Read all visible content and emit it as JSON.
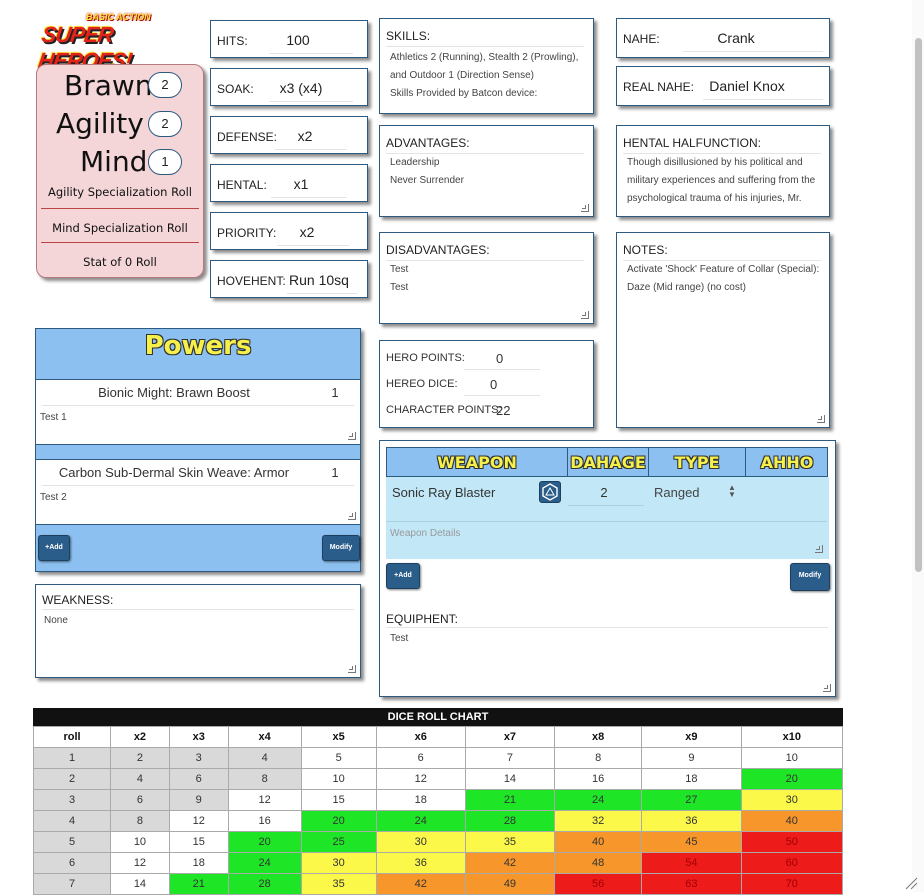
{
  "logo": {
    "top": "BASIC ACTION",
    "main": "SUPER HEROES!"
  },
  "stats": {
    "brawn_label": "Brawn",
    "brawn_value": "2",
    "agility_label": "Agility",
    "agility_value": "2",
    "mind_label": "Mind",
    "mind_value": "1",
    "agility_spec": "Agility Specialization Roll",
    "mind_spec": "Mind Specialization Roll",
    "stat0": "Stat of 0 Roll"
  },
  "combat": [
    {
      "label": "HITS:",
      "value": "100"
    },
    {
      "label": "SOAK:",
      "value": "x3 (x4)"
    },
    {
      "label": "DEFENSE:",
      "value": "x2"
    },
    {
      "label": "HENTAL:",
      "value": "x1"
    },
    {
      "label": "PRIORITY:",
      "value": "x2"
    },
    {
      "label": "HOVEHENT:",
      "value": "Run 10sq"
    }
  ],
  "skills": {
    "label": "SKILLS:",
    "lines": [
      "Athletics 2 (Running), Stealth 2 (Prowling),",
      "and Outdoor 1 (Direction Sense)",
      "Skills Provided by Batcon device:"
    ]
  },
  "advantages": {
    "label": "ADVANTAGES:",
    "lines": [
      "Leadership",
      "Never Surrender"
    ]
  },
  "disadvantages": {
    "label": "DISADVANTAGES:",
    "lines": [
      "Test",
      "Test"
    ]
  },
  "points": {
    "hero_label": "HERO POINTS:",
    "hero_value": "0",
    "dice_label": "HEREO DICE:",
    "dice_value": "0",
    "char_label": "CHARACTER POINTS:",
    "char_value": "22"
  },
  "identity": {
    "name_label": "NAHE:",
    "name_value": "Crank",
    "real_label": "REAL NAHE:",
    "real_value": "Daniel Knox"
  },
  "malfunction": {
    "label": "HENTAL HALFUNCTION:",
    "lines": [
      "Though disillusioned by his political and",
      "military experiences and suffering from the",
      "psychological trauma of his injuries, Mr."
    ]
  },
  "notes": {
    "label": "NOTES:",
    "lines": [
      "Activate 'Shock' Feature of Collar (Special):",
      "Daze (Mid range)  (no cost)"
    ]
  },
  "powers": {
    "title": "Powers",
    "items": [
      {
        "name": "Bionic Might: Brawn Boost",
        "rank": "1",
        "details": "Test 1"
      },
      {
        "name": "Carbon Sub-Dermal Skin Weave: Armor",
        "rank": "1",
        "details": "Test 2"
      }
    ],
    "add_label": "+Add",
    "modify_label": "Modify"
  },
  "weakness": {
    "label": "WEAKNESS:",
    "value": "None"
  },
  "weapons": {
    "headers": [
      "WEAPON",
      "DAHAGE",
      "TYPE",
      "AHHO"
    ],
    "row": {
      "name": "Sonic Ray Blaster",
      "damage": "2",
      "type": "Ranged",
      "ammo": ""
    },
    "details_placeholder": "Weapon Details",
    "add_label": "+Add",
    "modify_label": "Modify"
  },
  "equipment": {
    "label": "EQUIPHENT:",
    "value": "Test"
  },
  "dice_chart": {
    "title": "DICE ROLL CHART",
    "headers": [
      "roll",
      "x2",
      "x3",
      "x4",
      "x5",
      "x6",
      "x7",
      "x8",
      "x9",
      "x10"
    ],
    "rows": [
      [
        "1",
        "2",
        "3",
        "4",
        "5",
        "6",
        "7",
        "8",
        "9",
        "10"
      ],
      [
        "2",
        "4",
        "6",
        "8",
        "10",
        "12",
        "14",
        "16",
        "18",
        "20"
      ],
      [
        "3",
        "6",
        "9",
        "12",
        "15",
        "18",
        "21",
        "24",
        "27",
        "30"
      ],
      [
        "4",
        "8",
        "12",
        "16",
        "20",
        "24",
        "28",
        "32",
        "36",
        "40"
      ],
      [
        "5",
        "10",
        "15",
        "20",
        "25",
        "30",
        "35",
        "40",
        "45",
        "50"
      ],
      [
        "6",
        "12",
        "18",
        "24",
        "30",
        "36",
        "42",
        "48",
        "54",
        "60"
      ],
      [
        "7",
        "14",
        "21",
        "28",
        "35",
        "42",
        "49",
        "56",
        "63",
        "70"
      ]
    ],
    "colors": [
      [
        "gray",
        "gray",
        "gray",
        "gray",
        "",
        "",
        "",
        "",
        "",
        ""
      ],
      [
        "gray",
        "gray",
        "gray",
        "gray",
        "",
        "",
        "",
        "",
        "",
        "g"
      ],
      [
        "gray",
        "gray",
        "gray",
        "",
        "",
        "",
        "g",
        "g",
        "g",
        "y"
      ],
      [
        "gray",
        "gray",
        "",
        "",
        "g",
        "g",
        "g",
        "y",
        "y",
        "o"
      ],
      [
        "gray",
        "",
        "",
        "g",
        "g",
        "y",
        "y",
        "o",
        "o",
        "r"
      ],
      [
        "gray",
        "",
        "",
        "g",
        "y",
        "y",
        "o",
        "o",
        "r",
        "r"
      ],
      [
        "gray",
        "",
        "g",
        "g",
        "y",
        "o",
        "o",
        "r",
        "r",
        "r"
      ]
    ]
  }
}
